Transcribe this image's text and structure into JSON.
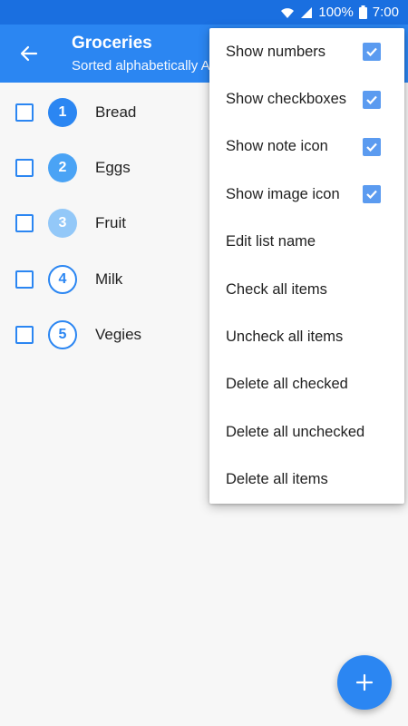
{
  "status_bar": {
    "battery_percent": "100%",
    "time": "7:00",
    "icons": [
      "wifi-icon",
      "signal-icon",
      "battery-icon"
    ]
  },
  "appbar": {
    "title": "Groceries",
    "subtitle": "Sorted alphabetically A",
    "back_icon": "arrow-left-icon"
  },
  "items": [
    {
      "number": "1",
      "label": "Bread",
      "badge_color": "#2b86f2",
      "style": "filled"
    },
    {
      "number": "2",
      "label": "Eggs",
      "badge_color": "#4aa3f5",
      "style": "filled"
    },
    {
      "number": "3",
      "label": "Fruit",
      "badge_color": "#93c8f8",
      "style": "filled"
    },
    {
      "number": "4",
      "label": "Milk",
      "badge_color": "#2b86f2",
      "style": "outline"
    },
    {
      "number": "5",
      "label": "Vegies",
      "badge_color": "#2b86f2",
      "style": "outline"
    }
  ],
  "menu": {
    "items": [
      {
        "label": "Show numbers",
        "checked": true
      },
      {
        "label": "Show checkboxes",
        "checked": true
      },
      {
        "label": "Show note icon",
        "checked": true
      },
      {
        "label": "Show image icon",
        "checked": true
      },
      {
        "label": "Edit list name"
      },
      {
        "label": "Check all items"
      },
      {
        "label": "Uncheck all items"
      },
      {
        "label": "Delete all checked"
      },
      {
        "label": "Delete all unchecked"
      },
      {
        "label": "Delete all items"
      }
    ]
  },
  "fab": {
    "icon": "plus-icon"
  },
  "colors": {
    "primary": "#2b86f2",
    "status_bar": "#1a6fe0",
    "check_fill": "#5b9bf0"
  }
}
